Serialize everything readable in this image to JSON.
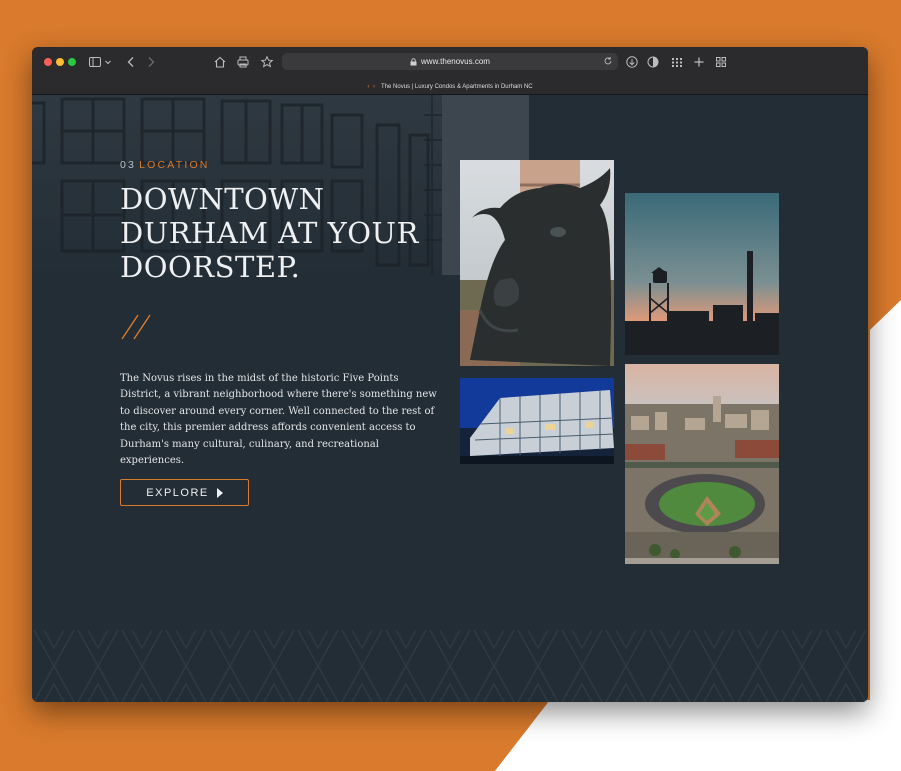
{
  "browser": {
    "url": "www.thenovus.com",
    "tab_title": "The Novus | Luxury Condos & Apartments in Durham NC",
    "tab_favicon": "‹ ›"
  },
  "section": {
    "number": "03",
    "label": "LOCATION",
    "headline_lines": [
      "DOWNTOWN",
      "DURHAM AT YOUR",
      "DOORSTEP."
    ],
    "body": "The Novus rises in the midst of the historic Five Points District, a vibrant neighborhood where there's something new to discover around every corner. Well connected to the rest of the city, this premier address affords convenient access to Durham's many cultural, culinary, and recreational experiences.",
    "cta_label": "EXPLORE"
  },
  "icons": {
    "sidebar": "sidebar-icon",
    "back": "chevron-left-icon",
    "forward": "chevron-right-icon",
    "home": "home-icon",
    "print": "printer-icon",
    "bookmark": "star-icon",
    "lock": "lock-icon",
    "reload": "reload-icon",
    "download": "download-icon",
    "privacy": "shield-icon",
    "extensions": "grid-icon",
    "new_tab": "plus-icon",
    "tabs": "tab-overview-icon"
  },
  "colors": {
    "accent": "#d87a2c",
    "page_bg": "#232d36",
    "backdrop": "#d97a2c"
  }
}
